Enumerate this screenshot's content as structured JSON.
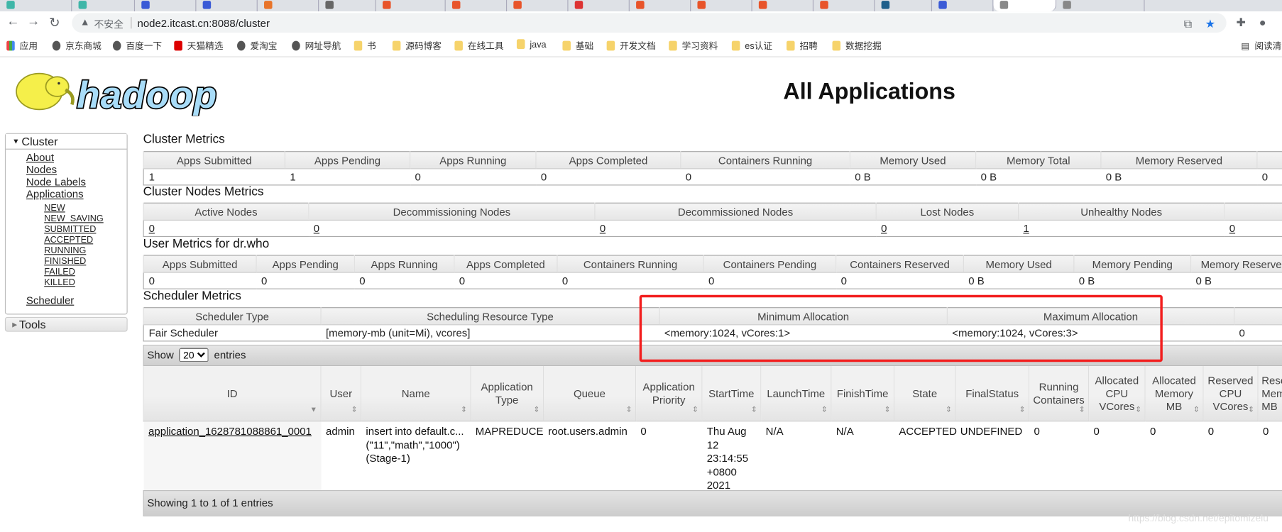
{
  "browser": {
    "tab_colors": [
      "#3fb6a8",
      "#3fb6a8",
      "#3a5ad6",
      "#3a5ad6",
      "#e8742a",
      "#666666",
      "#e8542a",
      "#e8542a",
      "#e8542a",
      "#d33",
      "#e8542a",
      "#e8542a",
      "#e8542a",
      "#e8542a",
      "#1f5f8b",
      "#3a5ad6",
      "#888888",
      "#888888"
    ],
    "insecure_label": "不安全",
    "url": "node2.itcast.cn:8088/cluster",
    "bookmarks": [
      {
        "label": "应用",
        "icon": "apps-grid-icon"
      },
      {
        "label": "京东商城",
        "icon": "globe-icon"
      },
      {
        "label": "百度一下",
        "icon": "globe-icon"
      },
      {
        "label": "天猫精选",
        "icon": "tmall-icon"
      },
      {
        "label": "爱淘宝",
        "icon": "globe-icon"
      },
      {
        "label": "网址导航",
        "icon": "globe-icon"
      },
      {
        "label": "书",
        "icon": "folder-icon"
      },
      {
        "label": "源码博客",
        "icon": "folder-icon"
      },
      {
        "label": "在线工具",
        "icon": "folder-icon"
      },
      {
        "label": "java",
        "icon": "folder-icon"
      },
      {
        "label": "基础",
        "icon": "folder-icon"
      },
      {
        "label": "开发文档",
        "icon": "folder-icon"
      },
      {
        "label": "学习资料",
        "icon": "folder-icon"
      },
      {
        "label": "es认证",
        "icon": "folder-icon"
      },
      {
        "label": "招聘",
        "icon": "folder-icon"
      },
      {
        "label": "数据挖掘",
        "icon": "folder-icon"
      }
    ],
    "reading_list": "阅读清"
  },
  "logo_text": "hadoop",
  "page_title": "All Applications",
  "sidebar": {
    "cluster": "Cluster",
    "links": [
      "About",
      "Nodes",
      "Node Labels",
      "Applications"
    ],
    "states": [
      "NEW",
      "NEW_SAVING",
      "SUBMITTED",
      "ACCEPTED",
      "RUNNING",
      "FINISHED",
      "FAILED",
      "KILLED"
    ],
    "scheduler": "Scheduler",
    "tools": "Tools"
  },
  "cluster_metrics": {
    "title": "Cluster Metrics",
    "headers": [
      "Apps Submitted",
      "Apps Pending",
      "Apps Running",
      "Apps Completed",
      "Containers Running",
      "Memory Used",
      "Memory Total",
      "Memory Reserved",
      ""
    ],
    "values": [
      "1",
      "1",
      "0",
      "0",
      "0",
      "0 B",
      "0 B",
      "0 B",
      "0"
    ]
  },
  "nodes_metrics": {
    "title": "Cluster Nodes Metrics",
    "headers": [
      "Active Nodes",
      "Decommissioning Nodes",
      "Decommissioned Nodes",
      "Lost Nodes",
      "Unhealthy Nodes",
      ""
    ],
    "values": [
      "0",
      "0",
      "0",
      "0",
      "1",
      "0"
    ]
  },
  "user_metrics": {
    "title": "User Metrics for dr.who",
    "headers": [
      "Apps Submitted",
      "Apps Pending",
      "Apps Running",
      "Apps Completed",
      "Containers Running",
      "Containers Pending",
      "Containers Reserved",
      "Memory Used",
      "Memory Pending",
      "Memory Reserved"
    ],
    "values": [
      "0",
      "0",
      "0",
      "0",
      "0",
      "0",
      "0",
      "0 B",
      "0 B",
      "0 B"
    ]
  },
  "scheduler_metrics": {
    "title": "Scheduler Metrics",
    "headers": [
      "Scheduler Type",
      "Scheduling Resource Type",
      "Minimum Allocation",
      "Maximum Allocation",
      ""
    ],
    "values": [
      "Fair Scheduler",
      "[memory-mb (unit=Mi), vcores]",
      "<memory:1024, vCores:1>",
      "<memory:1024, vCores:3>",
      "0"
    ]
  },
  "highlight_color": "#f21e1e",
  "apps": {
    "show_label": "Show",
    "page_size": "20",
    "entries_label": "entries",
    "headers": [
      "ID",
      "User",
      "Name",
      "Application Type",
      "Queue",
      "Application Priority",
      "StartTime",
      "LaunchTime",
      "FinishTime",
      "State",
      "FinalStatus",
      "Running Containers",
      "Allocated CPU VCores",
      "Allocated Memory MB",
      "Reserved CPU VCores",
      "Reserved Memory MB"
    ],
    "rows": [
      [
        "application_1628781088861_0001",
        "admin",
        "insert into default.c...(\"11\",\"math\",\"1000\")(Stage-1)",
        "MAPREDUCE",
        "root.users.admin",
        "0",
        "Thu Aug 12 23:14:55 +0800 2021",
        "N/A",
        "N/A",
        "ACCEPTED",
        "UNDEFINED",
        "0",
        "0",
        "0",
        "0",
        "0"
      ]
    ],
    "footer": "Showing 1 to 1 of 1 entries"
  },
  "watermark": "https://blog.csdn.net/epitomizelu"
}
